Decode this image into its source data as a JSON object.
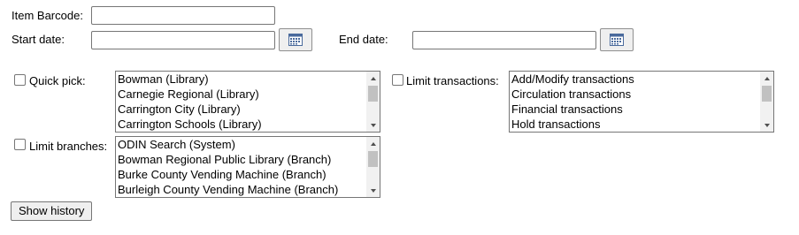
{
  "form": {
    "item_barcode_label": "Item Barcode:",
    "item_barcode_value": "",
    "start_date_label": "Start date:",
    "start_date_value": "",
    "end_date_label": "End date:",
    "end_date_value": "",
    "calendar_icon": "calendar-icon",
    "quick_pick": {
      "label": "Quick pick:",
      "checked": false,
      "options": [
        "Bowman (Library)",
        "Carnegie Regional (Library)",
        "Carrington City (Library)",
        "Carrington Schools (Library)"
      ]
    },
    "limit_transactions": {
      "label": "Limit transactions:",
      "checked": false,
      "options": [
        "Add/Modify transactions",
        "Circulation transactions",
        "Financial transactions",
        "Hold transactions"
      ]
    },
    "limit_branches": {
      "label": "Limit branches:",
      "checked": false,
      "options": [
        "ODIN Search (System)",
        "Bowman Regional Public Library (Branch)",
        "Burke County Vending Machine (Branch)",
        "Burleigh County Vending Machine (Branch)"
      ]
    },
    "submit_label": "Show history"
  }
}
